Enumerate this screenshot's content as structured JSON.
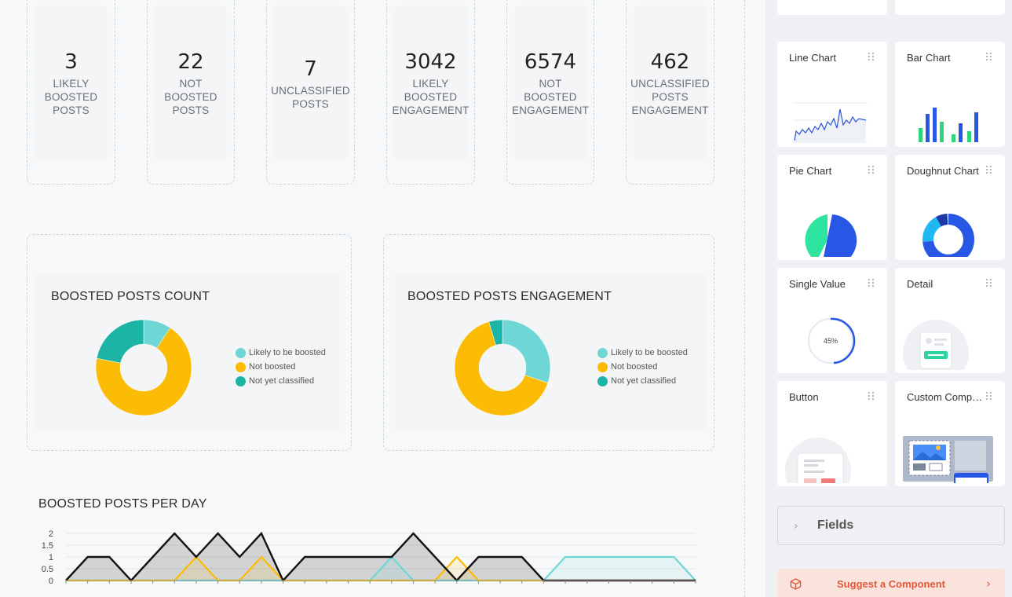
{
  "stats": [
    {
      "value": "3",
      "label_lines": [
        "LIKELY",
        "BOOSTED",
        "POSTS"
      ]
    },
    {
      "value": "22",
      "label_lines": [
        "NOT BOOSTED",
        "POSTS"
      ]
    },
    {
      "value": "7",
      "label_lines": [
        "UNCLASSIFIED",
        "POSTS"
      ]
    },
    {
      "value": "3042",
      "label_lines": [
        "LIKELY",
        "BOOSTED",
        "ENGAGEMENT"
      ]
    },
    {
      "value": "6574",
      "label_lines": [
        "NOT BOOSTED",
        "ENGAGEMENT"
      ]
    },
    {
      "value": "462",
      "label_lines": [
        "UNCLASSIFIED",
        "POSTS",
        "ENGAGEMENT"
      ]
    }
  ],
  "colors": {
    "likely": "#6fd6d6",
    "not_boosted": "#fcbc05",
    "unclassified": "#1cb5a5",
    "series_total": "#111111",
    "accent_blue": "#2857e6",
    "suggest_text": "#e0593a"
  },
  "legend": [
    "Likely to be boosted",
    "Not boosted",
    "Not yet classified"
  ],
  "chart_data": [
    {
      "type": "pie",
      "title": "BOOSTED POSTS COUNT",
      "donut": true,
      "labels": [
        "Likely to be boosted",
        "Not boosted",
        "Not yet classified"
      ],
      "values": [
        3,
        22,
        7
      ],
      "legend_position": "right"
    },
    {
      "type": "pie",
      "title": "BOOSTED POSTS ENGAGEMENT",
      "donut": true,
      "labels": [
        "Likely to be boosted",
        "Not boosted",
        "Not yet classified"
      ],
      "values": [
        3042,
        6574,
        462
      ],
      "legend_position": "right"
    },
    {
      "type": "area",
      "title": "BOOSTED POSTS PER DAY",
      "ylim": [
        0,
        2
      ],
      "yticks": [
        "0",
        "0.5",
        "1",
        "1.5",
        "2"
      ],
      "grid": true,
      "series": [
        {
          "name": "",
          "values": [
            0,
            1,
            1,
            0,
            1,
            2,
            1,
            2,
            1,
            2,
            0,
            1,
            1,
            1,
            1,
            1,
            2,
            1,
            0,
            1,
            1,
            1,
            0,
            0,
            0,
            0,
            0,
            0,
            0,
            0
          ]
        },
        {
          "name": "",
          "values": [
            0,
            0,
            0,
            0,
            0,
            0,
            1,
            0,
            0,
            1,
            0,
            0,
            0,
            0,
            0,
            0,
            0,
            0,
            1,
            0,
            0,
            0,
            0,
            0,
            0,
            0,
            0,
            0,
            0,
            0
          ]
        },
        {
          "name": "",
          "values": [
            0,
            0,
            0,
            0,
            0,
            0,
            0,
            0,
            0,
            0,
            0,
            0,
            0,
            0,
            0,
            1,
            0,
            0,
            0,
            0,
            0,
            0,
            0,
            1,
            1,
            1,
            1,
            1,
            1,
            0
          ]
        }
      ]
    }
  ],
  "panel": {
    "components": [
      {
        "title": "",
        "icon": "table-thumbnail-icon"
      },
      {
        "title": "",
        "icon": "timeline-thumbnail-icon"
      },
      {
        "title": "Line Chart",
        "icon": "line-chart-icon"
      },
      {
        "title": "Bar Chart",
        "icon": "bar-chart-icon"
      },
      {
        "title": "Pie Chart",
        "icon": "pie-chart-icon"
      },
      {
        "title": "Doughnut Chart",
        "icon": "doughnut-chart-icon"
      },
      {
        "title": "Single Value",
        "icon": "gauge-icon",
        "value": "45%"
      },
      {
        "title": "Detail",
        "icon": "detail-card-icon"
      },
      {
        "title": "Button",
        "icon": "button-icon"
      },
      {
        "title": "Custom Comp…",
        "icon": "custom-component-icon"
      }
    ],
    "fields_label": "Fields",
    "suggest_label": "Suggest a Component"
  }
}
